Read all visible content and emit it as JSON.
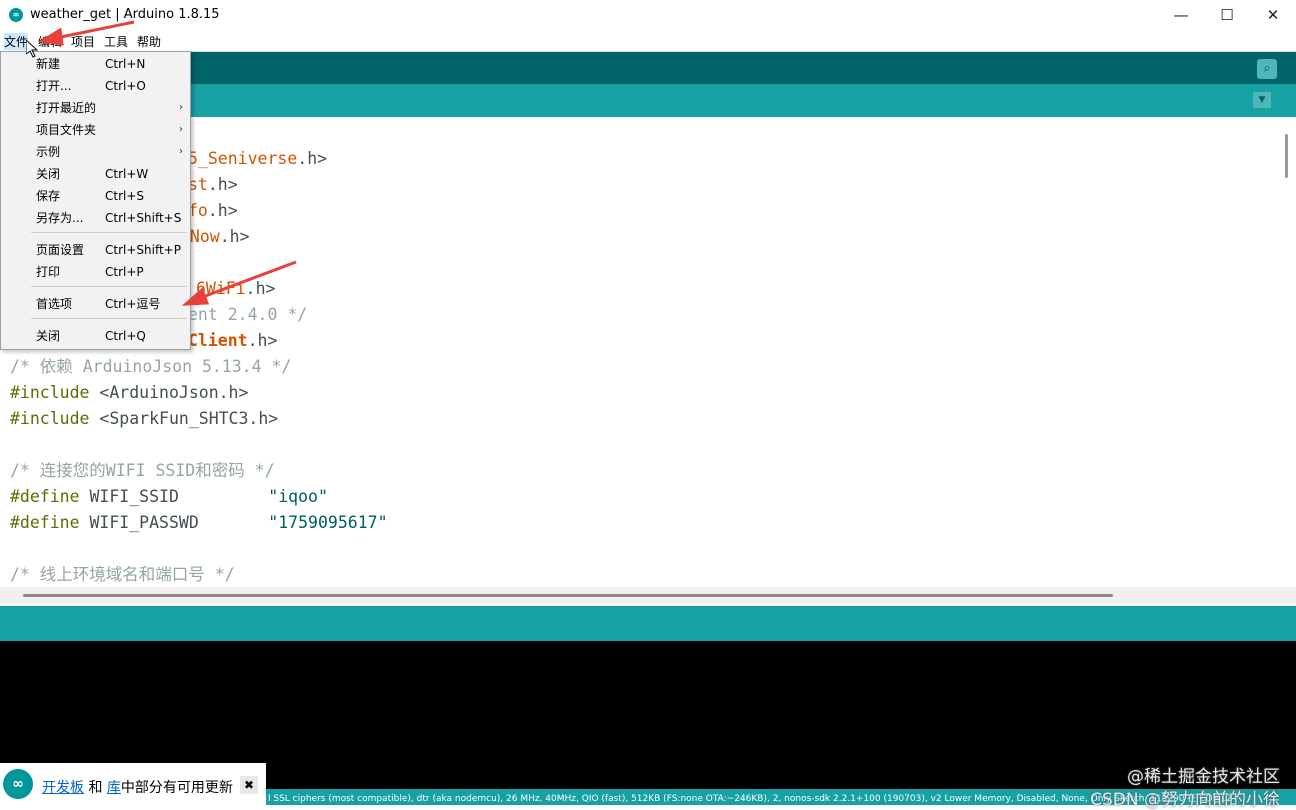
{
  "window": {
    "title": "weather_get | Arduino 1.8.15",
    "app_icon": "arduino-logo-icon",
    "minimize": "—",
    "maximize": "☐",
    "close": "✕"
  },
  "menubar": {
    "items": [
      {
        "label": "文件"
      },
      {
        "label": "编辑"
      },
      {
        "label": "项目"
      },
      {
        "label": "工具"
      },
      {
        "label": "帮助"
      }
    ]
  },
  "file_menu": {
    "items": [
      {
        "label": "新建",
        "shortcut": "Ctrl+N",
        "submenu": false
      },
      {
        "label": "打开...",
        "shortcut": "Ctrl+O",
        "submenu": false
      },
      {
        "label": "打开最近的",
        "shortcut": "",
        "submenu": true
      },
      {
        "label": "项目文件夹",
        "shortcut": "",
        "submenu": true
      },
      {
        "label": "示例",
        "shortcut": "",
        "submenu": true
      },
      {
        "label": "关闭",
        "shortcut": "Ctrl+W",
        "submenu": false
      },
      {
        "label": "保存",
        "shortcut": "Ctrl+S",
        "submenu": false
      },
      {
        "label": "另存为...",
        "shortcut": "Ctrl+Shift+S",
        "submenu": false
      },
      {
        "label": "页面设置",
        "shortcut": "Ctrl+Shift+P",
        "submenu": false
      },
      {
        "label": "打印",
        "shortcut": "Ctrl+P",
        "submenu": false
      },
      {
        "label": "首选项",
        "shortcut": "Ctrl+逗号",
        "submenu": false
      },
      {
        "label": "关闭",
        "shortcut": "Ctrl+Q",
        "submenu": false
      }
    ],
    "arrow_glyph": "›"
  },
  "toolbar": {
    "serial_monitor_icon": "magnifier-icon",
    "serial_monitor_glyph": "⌕",
    "tab_menu_glyph": "▼"
  },
  "editor": {
    "lines": [
      [
        {
          "t": "5_Seniverse",
          "c": "ty"
        },
        {
          "t": ".h>",
          "c": "dflt"
        }
      ],
      [
        {
          "t": "st",
          "c": "ty"
        },
        {
          "t": ".h>",
          "c": "dflt"
        }
      ],
      [
        {
          "t": "fo",
          "c": "ty"
        },
        {
          "t": ".h>",
          "c": "dflt"
        }
      ],
      [
        {
          "t": "rNow",
          "c": "ty"
        },
        {
          "t": ".h>",
          "c": "dflt"
        }
      ],
      [],
      [
        {
          "t": "6WiFi",
          "c": "ty"
        },
        {
          "t": ".h>",
          "c": "dflt"
        }
      ],
      [
        {
          "t": "ent 2.4.0 */",
          "c": "cmt"
        }
      ],
      [
        {
          "t": "Client",
          "c": "tyb"
        },
        {
          "t": ".h>",
          "c": "dflt"
        }
      ],
      [
        {
          "t": "/* 依赖 ArduinoJson 5.13.4 */",
          "c": "cmt"
        }
      ],
      [
        {
          "t": "#include",
          "c": "pre"
        },
        {
          "t": " <ArduinoJson.h>",
          "c": "dflt"
        }
      ],
      [
        {
          "t": "#include",
          "c": "pre"
        },
        {
          "t": " <SparkFun_SHTC3.h>",
          "c": "dflt"
        }
      ],
      [],
      [
        {
          "t": "/* 连接您的WIFI SSID和密码 */",
          "c": "cmt"
        }
      ],
      [
        {
          "t": "#define",
          "c": "pre"
        },
        {
          "t": " WIFI_SSID         ",
          "c": "dflt"
        },
        {
          "t": "\"iqoo\"",
          "c": "str"
        }
      ],
      [
        {
          "t": "#define",
          "c": "pre"
        },
        {
          "t": " WIFI_PASSWD       ",
          "c": "dflt"
        },
        {
          "t": "\"1759095617\"",
          "c": "str"
        }
      ],
      [],
      [
        {
          "t": "/* 线上环境域名和端口号 */",
          "c": "cmt"
        }
      ]
    ]
  },
  "status": {
    "board_info": "l SSL ciphers (most compatible), dtr (aka nodemcu), 26 MHz, 40MHz, QIO (fast), 512KB (FS:none OTA:~246KB), 2, nonos-sdk 2.2.1+100 (190703), v2 Lower Memory, Disabled, None, Only Sketch, 115200 在 COM12"
  },
  "notification": {
    "link1": "开发板",
    "text1": " 和 ",
    "link2": "库",
    "text2": "中部分有可用更新",
    "close": "✖",
    "logo": "arduino-logo-icon"
  },
  "watermark": {
    "line1": "@稀土掘金技术社区",
    "line2": "CSDN @努力向前的小徐"
  },
  "colors": {
    "teal_dark": "#006468",
    "teal": "#17a1a5",
    "annotation_red": "#e8403a"
  }
}
